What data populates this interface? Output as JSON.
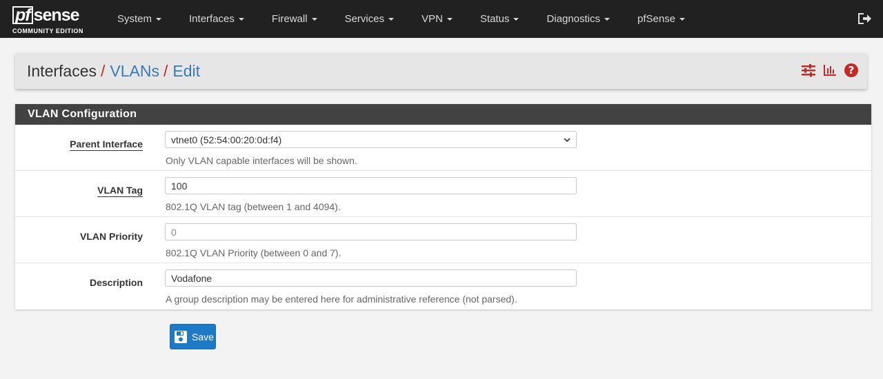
{
  "brand": {
    "name": "sense",
    "prefix": "pf",
    "edition": "COMMUNITY EDITION"
  },
  "nav": {
    "items": [
      {
        "label": "System"
      },
      {
        "label": "Interfaces"
      },
      {
        "label": "Firewall"
      },
      {
        "label": "Services"
      },
      {
        "label": "VPN"
      },
      {
        "label": "Status"
      },
      {
        "label": "Diagnostics"
      },
      {
        "label": "pfSense"
      }
    ]
  },
  "breadcrumb": {
    "root": "Interfaces",
    "vlans": "VLANs",
    "edit": "Edit",
    "separator": "/"
  },
  "panel": {
    "title": "VLAN Configuration"
  },
  "form": {
    "parent_interface": {
      "label": "Parent Interface",
      "value": "vtnet0 (52:54:00:20:0d:f4)",
      "help": "Only VLAN capable interfaces will be shown."
    },
    "vlan_tag": {
      "label": "VLAN Tag",
      "value": "100",
      "help": "802.1Q VLAN tag (between 1 and 4094)."
    },
    "vlan_priority": {
      "label": "VLAN Priority",
      "placeholder": "0",
      "help": "802.1Q VLAN Priority (between 0 and 7)."
    },
    "description": {
      "label": "Description",
      "value": "Vodafone",
      "help": "A group description may be entered here for administrative reference (not parsed)."
    }
  },
  "save_button": {
    "label": "Save"
  },
  "colors": {
    "navbar": "#212121",
    "accent_red": "#c62828",
    "link_blue": "#3a7ab8",
    "button_blue": "#1f7ac6",
    "panel_heading": "#424242"
  },
  "icons": [
    "logout-icon",
    "settings-sliders-icon",
    "bar-chart-icon",
    "help-icon",
    "save-disk-icon",
    "chevron-down-icon"
  ]
}
